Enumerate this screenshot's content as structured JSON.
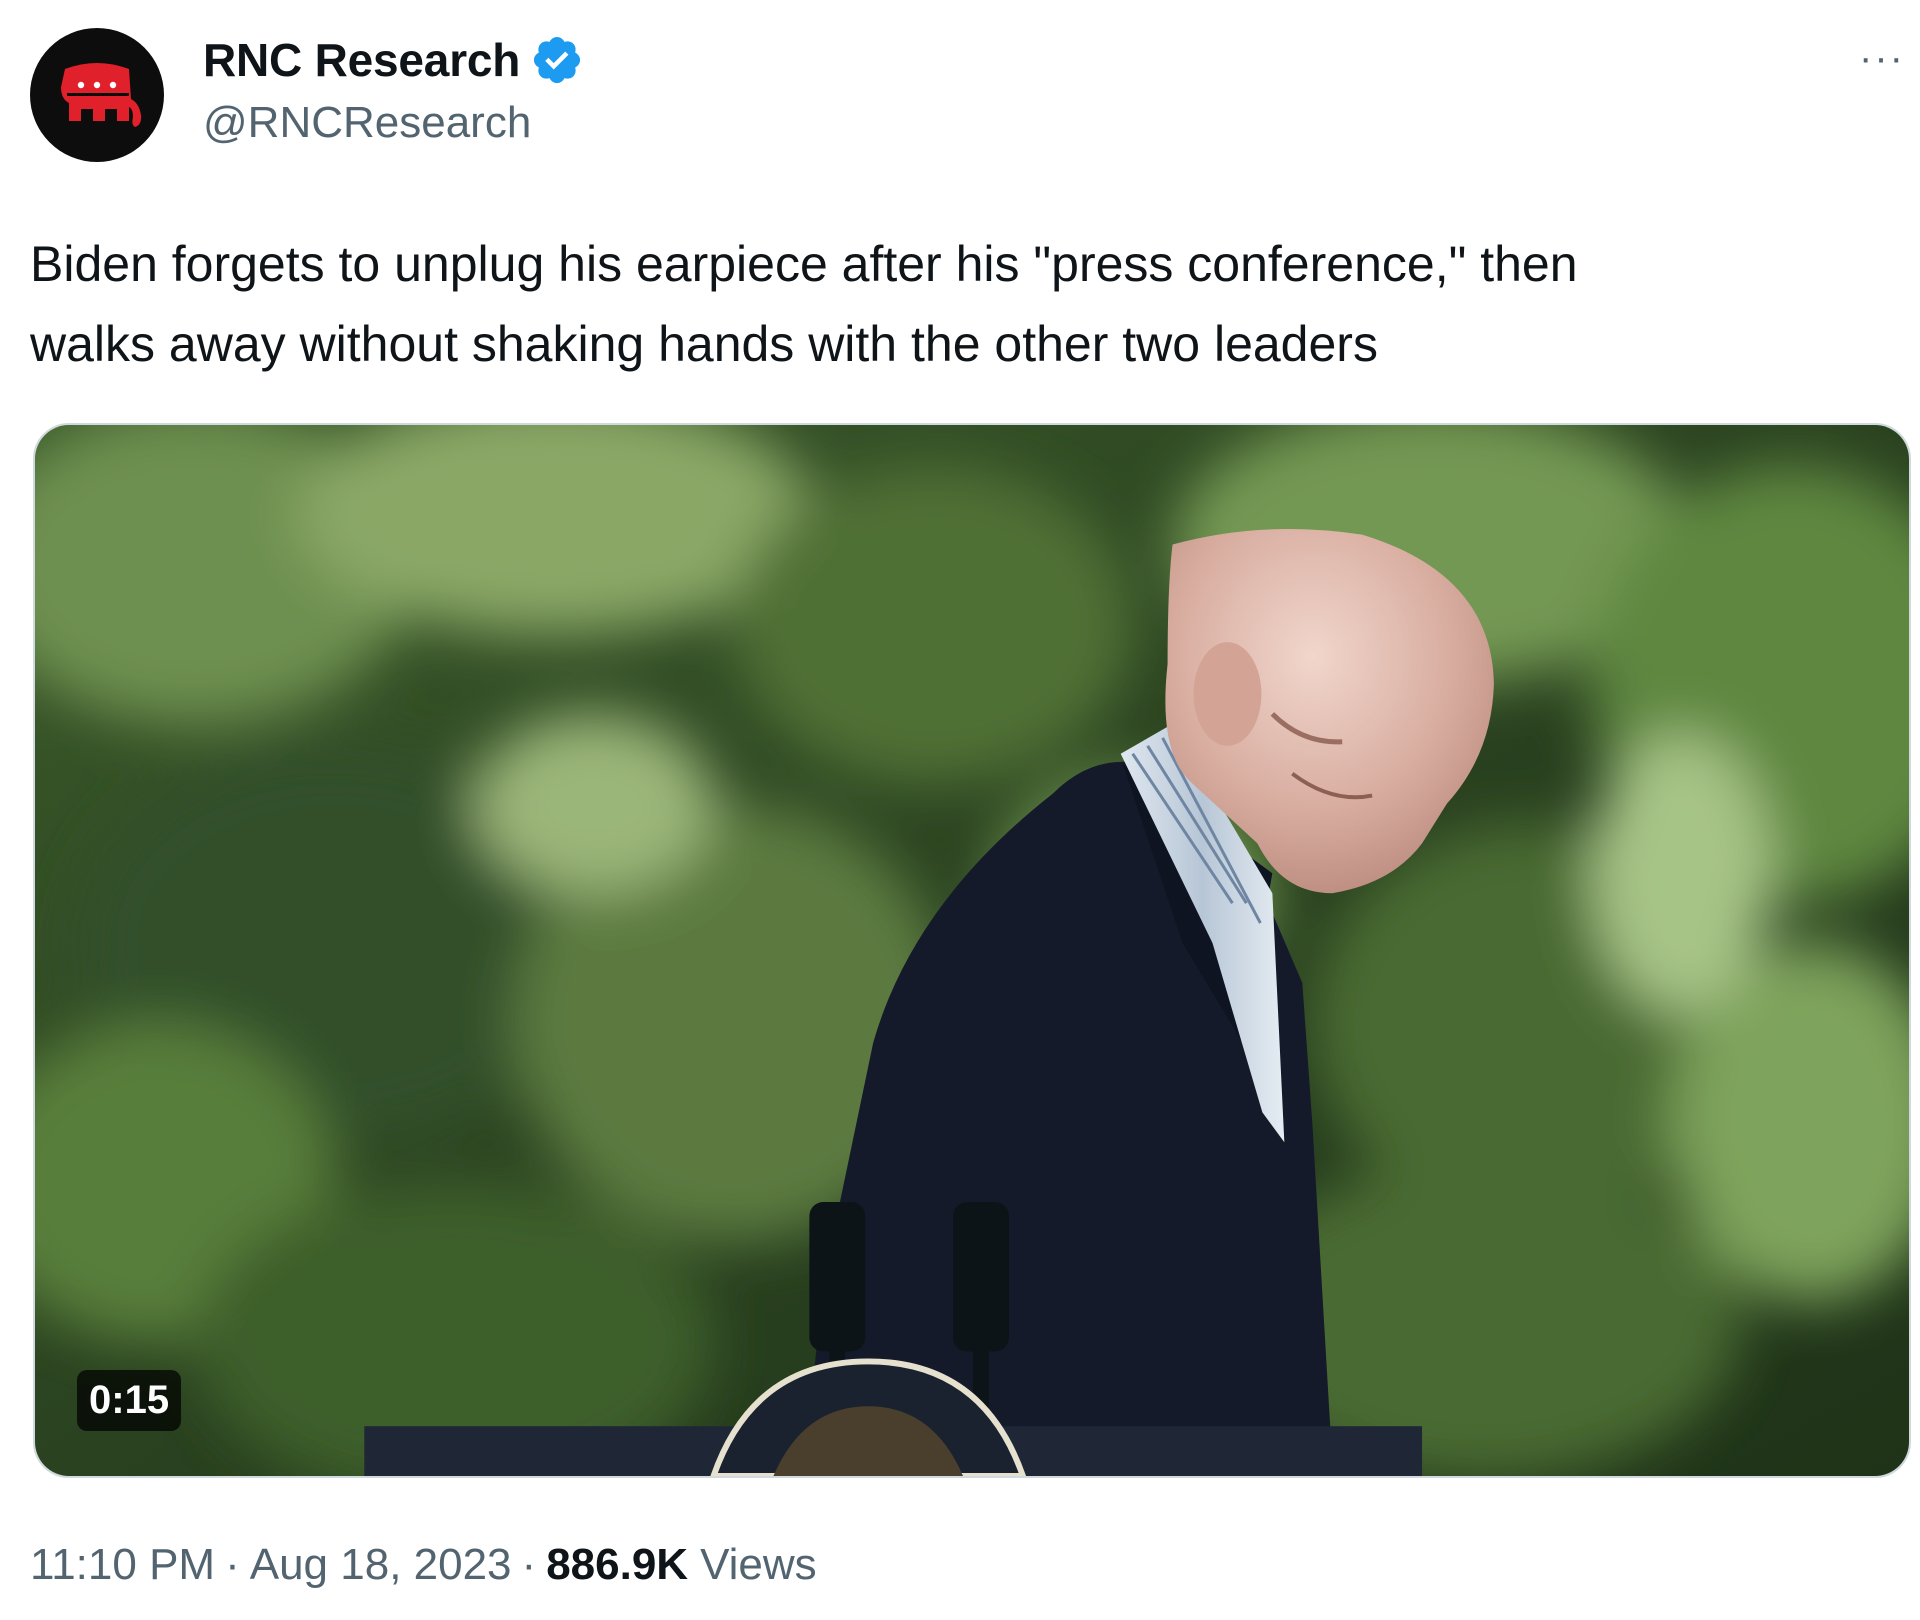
{
  "author": {
    "display_name": "RNC Research",
    "handle": "@RNCResearch",
    "avatar_icon": "republican-elephant-icon",
    "verified_icon": "verified-badge-icon",
    "colors": {
      "avatar_bg": "#0d0d0d",
      "elephant": "#e0202a",
      "verified": "#1d9bf0"
    }
  },
  "menu": {
    "more_label": "···"
  },
  "tweet": {
    "text_line1": "Biden forgets to unplug his earpiece after his \"press conference,\" then",
    "text_line2": "walks away without shaking hands with the other two leaders"
  },
  "media": {
    "type": "video",
    "duration": "0:15"
  },
  "meta": {
    "time": "11:10 PM",
    "separator": "·",
    "date": "Aug 18, 2023",
    "views_count": "886.9K",
    "views_label": "Views"
  }
}
